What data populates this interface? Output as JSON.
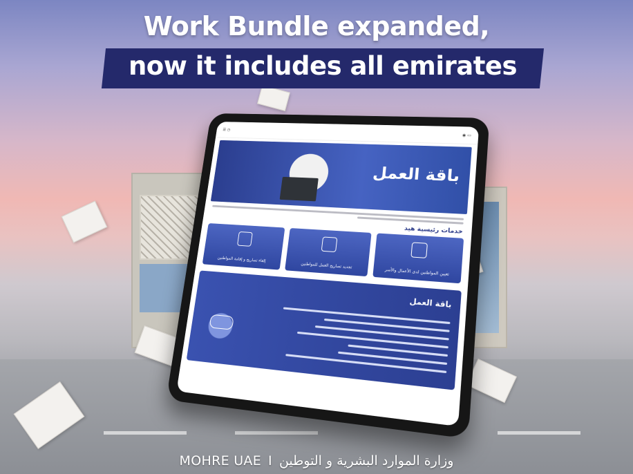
{
  "header": {
    "line1": "Work Bundle expanded,",
    "line2": "now it includes all emirates"
  },
  "tablet": {
    "hero_title": "باقة العمل",
    "services_heading": "خدمات رئيسية هيد",
    "cards": [
      "تعيين المواطنين لدى الأعمال والأسر",
      "تجديد تصاريح العمل للمواطنين",
      "إلغاء تصاريح و إقامة المواطنين"
    ],
    "bundle_title": "باقة العمل"
  },
  "footer": {
    "brand": "MOHRE UAE",
    "separator": "I",
    "ministry": "وزارة الموارد البشرية و التوطين"
  },
  "colors": {
    "banner": "#24296b",
    "brand_blue": "#3a52b0"
  }
}
